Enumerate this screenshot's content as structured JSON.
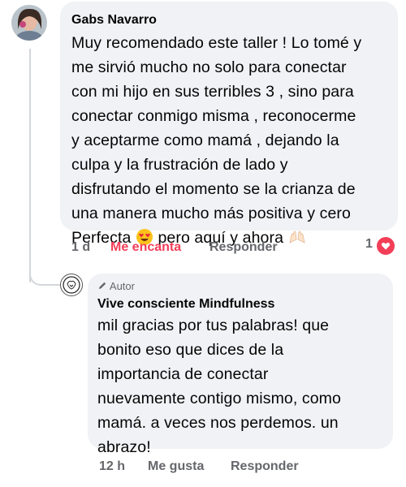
{
  "comment": {
    "author": "Gabs Navarro",
    "lines": [
      "Muy recomendado este taller ! Lo tomé y",
      "me sirvió mucho no solo para conectar",
      "con mi hijo en sus terribles 3 ,  sino para",
      "conectar conmigo misma , reconocerme",
      "y aceptarme como mamá , dejando la",
      "culpa y la frustración de lado y",
      "disfrutando el momento se la crianza de",
      "una manera mucho más positiva y cero"
    ],
    "last_line_start": "Perfecta",
    "last_line_end": "pero aquí y ahora",
    "emoji_1": "heart-eyes-emoji",
    "emoji_2": "raising-hands-emoji",
    "time": "1 d",
    "like_label": "Me encanta",
    "reply_label": "Responder",
    "reaction_count": "1",
    "reaction_icon": "heart-reaction-icon"
  },
  "reply": {
    "badge": "Autor",
    "author": "Vive consciente Mindfulness",
    "lines": [
      "mil gracias por tus palabras! que",
      "bonito eso que dices de la",
      "importancia de conectar",
      "nuevamente contigo mismo, como",
      "mamá. a veces nos perdemos. un",
      "abrazo!"
    ],
    "time": "12 h",
    "like_label": "Me gusta",
    "reply_label": "Responder"
  },
  "colors": {
    "bubble": "#f0f2f5",
    "love": "#f33e58",
    "muted": "#65676b"
  }
}
